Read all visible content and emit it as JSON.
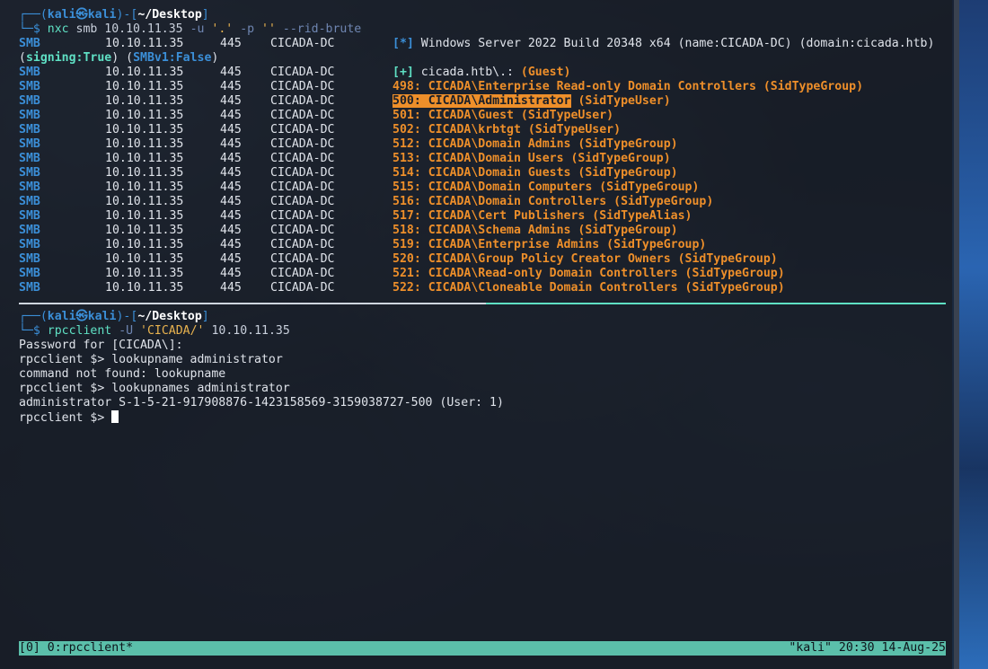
{
  "prompt1": {
    "frame_open": "┌──(",
    "user": "kali",
    "at": "㉿",
    "host": "kali",
    "mid": ")-[",
    "path": "~/Desktop",
    "close": "]",
    "frame_cmd": "└─$ "
  },
  "command1": {
    "cmd": "nxc",
    "rest": " smb 10.10.11.35 ",
    "opt1": "-u",
    "str1": "'.'",
    "opt2": "-p",
    "str2": "''",
    "opt3": "--rid-brute"
  },
  "smb_line1": {
    "proto": "SMB",
    "ip": "10.10.11.35",
    "port": "445",
    "host": "CICADA-DC",
    "tag": "[*]",
    "text": " Windows Server 2022 Build 20348 x64 (name:CICADA-DC) (domain:cicada.htb)"
  },
  "smb_line1_cont": {
    "open": "(",
    "signing": "signing:True",
    "mid": ") (",
    "smbv1": "SMBv1:False",
    "close": ")"
  },
  "smb_line2": {
    "proto": "SMB",
    "ip": "10.10.11.35",
    "port": "445",
    "host": "CICADA-DC",
    "tag": "[+]",
    "text": " cicada.htb\\.: ",
    "guest": "(Guest)"
  },
  "rid_rows": [
    {
      "proto": "SMB",
      "ip": "10.10.11.35",
      "port": "445",
      "host": "CICADA-DC",
      "text": "498: CICADA\\Enterprise Read-only Domain Controllers (SidTypeGroup)"
    },
    {
      "proto": "SMB",
      "ip": "10.10.11.35",
      "port": "445",
      "host": "CICADA-DC",
      "hl": "500: CICADA\\Administrator",
      "text": " (SidTypeUser)"
    },
    {
      "proto": "SMB",
      "ip": "10.10.11.35",
      "port": "445",
      "host": "CICADA-DC",
      "text": "501: CICADA\\Guest (SidTypeUser)"
    },
    {
      "proto": "SMB",
      "ip": "10.10.11.35",
      "port": "445",
      "host": "CICADA-DC",
      "text": "502: CICADA\\krbtgt (SidTypeUser)"
    },
    {
      "proto": "SMB",
      "ip": "10.10.11.35",
      "port": "445",
      "host": "CICADA-DC",
      "text": "512: CICADA\\Domain Admins (SidTypeGroup)"
    },
    {
      "proto": "SMB",
      "ip": "10.10.11.35",
      "port": "445",
      "host": "CICADA-DC",
      "text": "513: CICADA\\Domain Users (SidTypeGroup)"
    },
    {
      "proto": "SMB",
      "ip": "10.10.11.35",
      "port": "445",
      "host": "CICADA-DC",
      "text": "514: CICADA\\Domain Guests (SidTypeGroup)"
    },
    {
      "proto": "SMB",
      "ip": "10.10.11.35",
      "port": "445",
      "host": "CICADA-DC",
      "text": "515: CICADA\\Domain Computers (SidTypeGroup)"
    },
    {
      "proto": "SMB",
      "ip": "10.10.11.35",
      "port": "445",
      "host": "CICADA-DC",
      "text": "516: CICADA\\Domain Controllers (SidTypeGroup)"
    },
    {
      "proto": "SMB",
      "ip": "10.10.11.35",
      "port": "445",
      "host": "CICADA-DC",
      "text": "517: CICADA\\Cert Publishers (SidTypeAlias)"
    },
    {
      "proto": "SMB",
      "ip": "10.10.11.35",
      "port": "445",
      "host": "CICADA-DC",
      "text": "518: CICADA\\Schema Admins (SidTypeGroup)"
    },
    {
      "proto": "SMB",
      "ip": "10.10.11.35",
      "port": "445",
      "host": "CICADA-DC",
      "text": "519: CICADA\\Enterprise Admins (SidTypeGroup)"
    },
    {
      "proto": "SMB",
      "ip": "10.10.11.35",
      "port": "445",
      "host": "CICADA-DC",
      "text": "520: CICADA\\Group Policy Creator Owners (SidTypeGroup)"
    },
    {
      "proto": "SMB",
      "ip": "10.10.11.35",
      "port": "445",
      "host": "CICADA-DC",
      "text": "521: CICADA\\Read-only Domain Controllers (SidTypeGroup)"
    },
    {
      "proto": "SMB",
      "ip": "10.10.11.35",
      "port": "445",
      "host": "CICADA-DC",
      "text": "522: CICADA\\Cloneable Domain Controllers (SidTypeGroup)"
    }
  ],
  "prompt2": {
    "frame_open": "┌──(",
    "user": "kali",
    "at": "㉿",
    "host": "kali",
    "mid": ")-[",
    "path": "~/Desktop",
    "close": "]",
    "frame_cmd": "└─$ "
  },
  "command2": {
    "cmd": "rpcclient",
    "opt1": "-U",
    "str1": "'CICADA/'",
    "rest": " 10.10.11.35"
  },
  "rpc_output": [
    "Password for [CICADA\\]:",
    "rpcclient $> lookupname administrator",
    "command not found: lookupname",
    "rpcclient $> lookupnames administrator",
    "administrator S-1-5-21-917908876-1423158569-3159038727-500 (User: 1)"
  ],
  "rpc_prompt": "rpcclient $> ",
  "tmux": {
    "left": "[0] 0:rpcclient*",
    "right": "\"kali\" 20:30 14-Aug-25"
  }
}
